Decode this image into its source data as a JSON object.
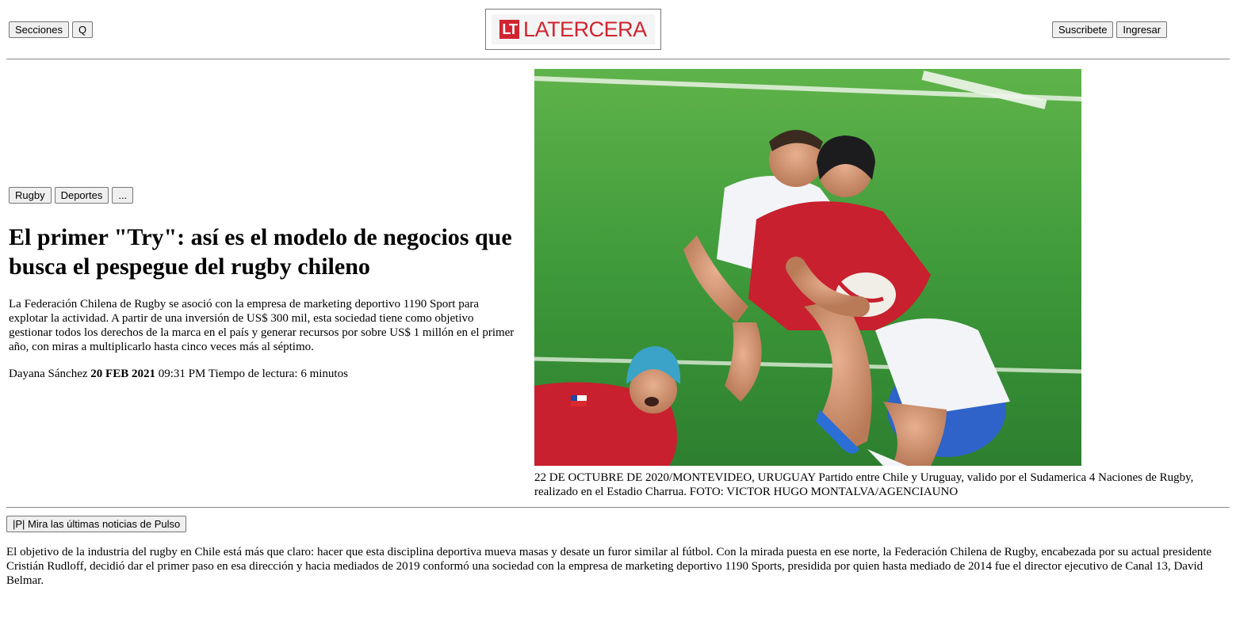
{
  "header": {
    "sections_label": "Secciones",
    "search_label": "Q",
    "logo_badge": "LT",
    "logo_name": "LATERCERA",
    "subscribe_label": "Suscribete",
    "login_label": "Ingresar"
  },
  "article": {
    "tags": [
      "Rugby",
      "Deportes",
      "..."
    ],
    "headline": "El primer \"Try\": así es el modelo de negocios que busca el pespegue del rugby chileno",
    "summary": "La Federación Chilena de Rugby se asoció con la empresa de marketing deportivo 1190 Sport para explotar la actividad. A partir de una inversión de US$ 300 mil, esta sociedad tiene como objetivo gestionar todos los derechos de la marca en el país y generar recursos por sobre US$ 1 millón en el primer año, con miras a multiplicarlo hasta cinco veces más al séptimo.",
    "author": "Dayana Sánchez",
    "date": "20 FEB 2021",
    "time": "09:31 PM",
    "reading_time": "Tiempo de lectura: 6 minutos",
    "photo_caption": "22 DE OCTUBRE DE 2020/MONTEVIDEO, URUGUAY Partido entre Chile y Uruguay, valido por el Sudamerica 4 Naciones de Rugby, realizado en el Estadio Charrua. FOTO: VICTOR HUGO MONTALVA/AGENCIAUNO",
    "pulso_button": "|P| Mira las últimas noticias de Pulso",
    "body_paragraph": "El objetivo de la industria del rugby en Chile está más que claro: hacer que esta disciplina deportiva mueva masas y desate un furor similar al fútbol. Con la mirada puesta en ese norte, la Federación Chilena de Rugby, encabezada por su actual presidente Cristián Rudloff, decidió dar el primer paso en esa dirección y hacia mediados de 2019 conformó una sociedad con la empresa de marketing deportivo 1190 Sports, presidida por quien hasta mediado de 2014 fue el director ejecutivo de Canal 13, David Belmar."
  },
  "colors": {
    "brand_red": "#d12430",
    "pitch_green": "#3f9a3a",
    "chile_red": "#c8202e",
    "uruguay_blue": "#2f63c9"
  }
}
